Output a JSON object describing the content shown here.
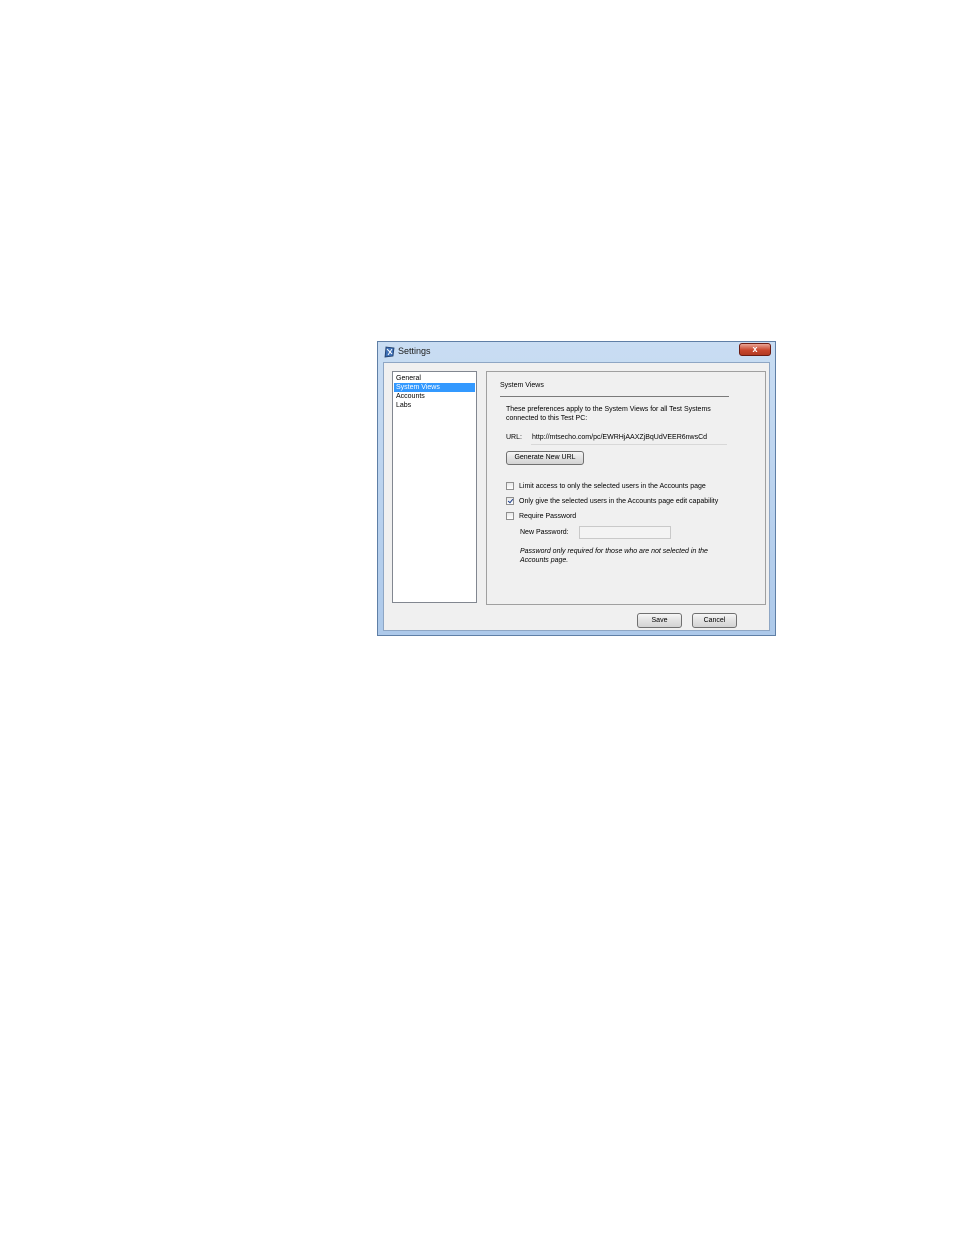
{
  "window": {
    "title": "Settings",
    "close_label": "x"
  },
  "nav": {
    "items": [
      {
        "label": "General"
      },
      {
        "label": "System Views"
      },
      {
        "label": "Accounts"
      },
      {
        "label": "Labs"
      }
    ],
    "selected": "System Views"
  },
  "panel": {
    "title": "System Views",
    "description": "These preferences apply to the System Views for all Test Systems connected to this Test PC:",
    "url_label": "URL:",
    "url_value": "http://mtsecho.com/pc/EWRHjAAXZjBqUdVEER6nwsCd",
    "generate_button": "Generate New URL",
    "options": [
      {
        "label": "Limit access to only the selected users in the Accounts page",
        "checked": false
      },
      {
        "label": "Only give the selected users in the Accounts page edit capability",
        "checked": true
      },
      {
        "label": "Require Password",
        "checked": false
      }
    ],
    "password_label": "New Password:",
    "password_value": "",
    "note": "Password only required for those who are not selected in the Accounts page."
  },
  "footer": {
    "save_label": "Save",
    "cancel_label": "Cancel"
  },
  "colors": {
    "selection": "#3399ff",
    "close_button": "#c9472e",
    "titlebar": "#b9d1ea"
  }
}
